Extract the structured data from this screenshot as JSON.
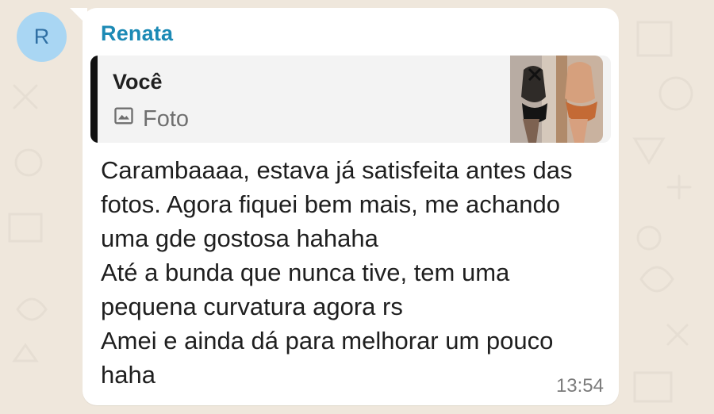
{
  "chat": {
    "avatar_initial": "R",
    "sender_name": "Renata",
    "reply": {
      "author": "Você",
      "media_label": "Foto",
      "media_icon": "image-icon"
    },
    "message_text": "Carambaaaa, estava já satisfeita antes das fotos. Agora fiquei bem mais, me achando uma gde gostosa hahaha\nAté a bunda que nunca tive, tem uma pequena curvatura agora rs\nAmei e ainda dá para melhorar um pouco haha",
    "timestamp": "13:54"
  },
  "colors": {
    "background": "#efe7dc",
    "bubble": "#ffffff",
    "sender_name": "#1c8ab5",
    "quote_bar": "#111111",
    "avatar": "#a9d6f3"
  }
}
